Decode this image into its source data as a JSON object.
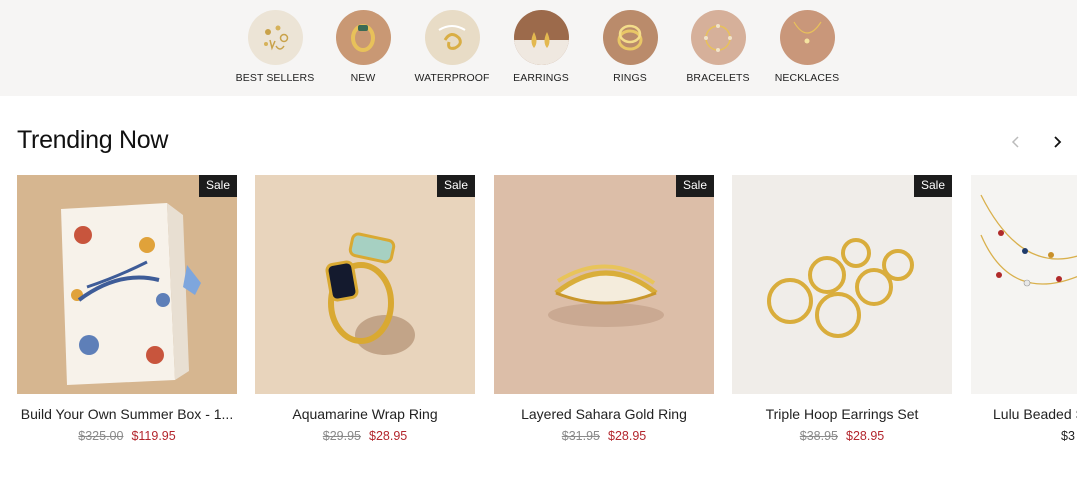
{
  "categories": [
    {
      "label": "BEST SELLERS",
      "icon": "gold-earrings-cluster-icon",
      "color": "#ece4d6"
    },
    {
      "label": "NEW",
      "icon": "gold-chain-ring-icon",
      "color": "#c99874"
    },
    {
      "label": "WATERPROOF",
      "icon": "gold-spiral-earring-icon",
      "color": "#e8dcc6"
    },
    {
      "label": "EARRINGS",
      "icon": "gold-drop-earrings-icon",
      "color": "#9c6a4b"
    },
    {
      "label": "RINGS",
      "icon": "gold-stacked-rings-icon",
      "color": "#ba8b6b"
    },
    {
      "label": "BRACELETS",
      "icon": "gold-bead-bracelet-icon",
      "color": "#d6b09a"
    },
    {
      "label": "NECKLACES",
      "icon": "gold-pendant-necklace-icon",
      "color": "#c9977a"
    }
  ],
  "section": {
    "title": "Trending Now",
    "prev_icon": "chevron-left-icon",
    "next_icon": "chevron-right-icon"
  },
  "products": [
    {
      "title": "Build Your Own Summer Box - 1...",
      "old_price": "$325.00",
      "price": "$119.95",
      "badge": "Sale",
      "image": "summer-box-icon"
    },
    {
      "title": "Aquamarine Wrap Ring",
      "old_price": "$29.95",
      "price": "$28.95",
      "badge": "Sale",
      "image": "wrap-ring-icon"
    },
    {
      "title": "Layered Sahara Gold Ring",
      "old_price": "$31.95",
      "price": "$28.95",
      "badge": "Sale",
      "image": "sahara-ring-icon"
    },
    {
      "title": "Triple Hoop Earrings Set",
      "old_price": "$38.95",
      "price": "$28.95",
      "badge": "Sale",
      "image": "hoop-earrings-icon"
    },
    {
      "title": "Lulu Beaded S",
      "old_price": "",
      "price": "$3",
      "badge": "",
      "image": "beaded-necklace-icon"
    }
  ]
}
